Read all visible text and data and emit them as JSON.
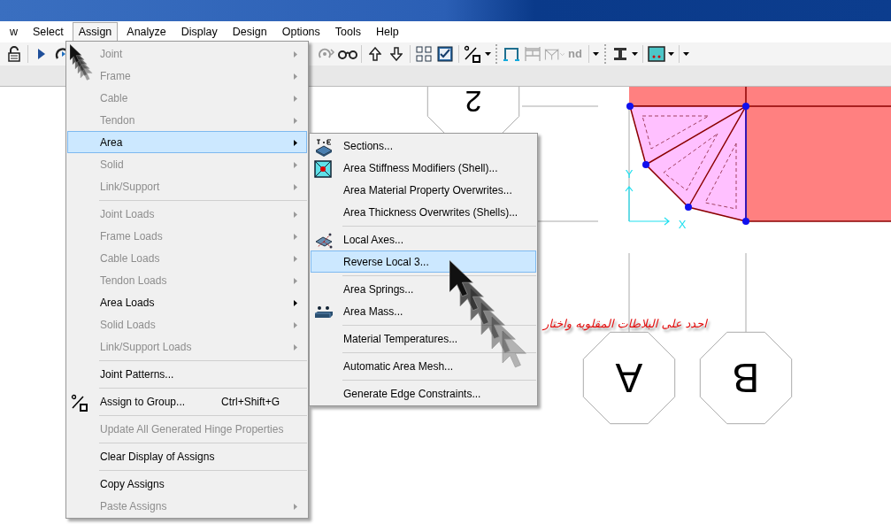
{
  "menubar": [
    {
      "label": "w",
      "selected": false
    },
    {
      "label": "Select",
      "selected": false
    },
    {
      "label": "Assign",
      "selected": true
    },
    {
      "label": "Analyze",
      "selected": false
    },
    {
      "label": "Display",
      "selected": false
    },
    {
      "label": "Design",
      "selected": false
    },
    {
      "label": "Options",
      "selected": false
    },
    {
      "label": "Tools",
      "selected": false
    },
    {
      "label": "Help",
      "selected": false
    }
  ],
  "toolbar": {
    "left": [
      {
        "kind": "icon"
      },
      {
        "kind": "sep"
      },
      {
        "kind": "icon"
      },
      {
        "kind": "icon"
      }
    ],
    "right": [
      {
        "kind": "icon"
      },
      {
        "kind": "icon"
      },
      {
        "kind": "sep"
      },
      {
        "kind": "icon"
      },
      {
        "kind": "icon"
      },
      {
        "kind": "sep"
      },
      {
        "kind": "icon"
      },
      {
        "kind": "icon"
      },
      {
        "kind": "sep"
      },
      {
        "kind": "icon"
      },
      {
        "kind": "caret"
      },
      {
        "kind": "grip"
      },
      {
        "kind": "icon"
      },
      {
        "kind": "icon"
      },
      {
        "kind": "icon"
      },
      {
        "kind": "text",
        "label": "nd",
        "disabled": true
      },
      {
        "kind": "sep"
      },
      {
        "kind": "caret"
      },
      {
        "kind": "grip"
      },
      {
        "kind": "icon"
      },
      {
        "kind": "caret"
      },
      {
        "kind": "sep"
      },
      {
        "kind": "icon"
      },
      {
        "kind": "caret"
      },
      {
        "kind": "sep"
      },
      {
        "kind": "caret"
      }
    ]
  },
  "assign_menu": [
    {
      "kind": "item",
      "label": "Joint",
      "disabled": true,
      "submenu": true,
      "selected": false
    },
    {
      "kind": "item",
      "label": "Frame",
      "disabled": true,
      "submenu": true,
      "selected": false
    },
    {
      "kind": "item",
      "label": "Cable",
      "disabled": true,
      "submenu": true,
      "selected": false
    },
    {
      "kind": "item",
      "label": "Tendon",
      "disabled": true,
      "submenu": true,
      "selected": false
    },
    {
      "kind": "item",
      "label": "Area",
      "disabled": false,
      "submenu": true,
      "selected": true
    },
    {
      "kind": "item",
      "label": "Solid",
      "disabled": true,
      "submenu": true,
      "selected": false
    },
    {
      "kind": "item",
      "label": "Link/Support",
      "disabled": true,
      "submenu": true,
      "selected": false
    },
    {
      "kind": "separator"
    },
    {
      "kind": "item",
      "label": "Joint Loads",
      "disabled": true,
      "submenu": true,
      "selected": false
    },
    {
      "kind": "item",
      "label": "Frame Loads",
      "disabled": true,
      "submenu": true,
      "selected": false
    },
    {
      "kind": "item",
      "label": "Cable Loads",
      "disabled": true,
      "submenu": true,
      "selected": false
    },
    {
      "kind": "item",
      "label": "Tendon Loads",
      "disabled": true,
      "submenu": true,
      "selected": false
    },
    {
      "kind": "item",
      "label": "Area Loads",
      "disabled": false,
      "submenu": true,
      "selected": false
    },
    {
      "kind": "item",
      "label": "Solid Loads",
      "disabled": true,
      "submenu": true,
      "selected": false
    },
    {
      "kind": "item",
      "label": "Link/Support Loads",
      "disabled": true,
      "submenu": true,
      "selected": false
    },
    {
      "kind": "separator"
    },
    {
      "kind": "item",
      "label": "Joint Patterns...",
      "disabled": false,
      "submenu": false,
      "selected": false
    },
    {
      "kind": "separator"
    },
    {
      "kind": "icon_item",
      "label": "Assign to Group...",
      "shortcut": "Ctrl+Shift+G",
      "disabled": false,
      "submenu": false,
      "selected": false
    },
    {
      "kind": "separator"
    },
    {
      "kind": "item",
      "label": "Update All Generated Hinge Properties",
      "disabled": true,
      "submenu": false,
      "selected": false
    },
    {
      "kind": "separator"
    },
    {
      "kind": "item",
      "label": "Clear Display of Assigns",
      "disabled": false,
      "submenu": false,
      "selected": false
    },
    {
      "kind": "separator"
    },
    {
      "kind": "item",
      "label": "Copy Assigns",
      "disabled": false,
      "submenu": false,
      "selected": false
    },
    {
      "kind": "item",
      "label": "Paste Assigns",
      "disabled": true,
      "submenu": true,
      "selected": false
    }
  ],
  "area_submenu": [
    {
      "kind": "icon_item",
      "label": "Sections...",
      "selected": false
    },
    {
      "kind": "icon_item",
      "label": "Area Stiffness Modifiers (Shell)...",
      "selected": false
    },
    {
      "kind": "item",
      "label": "Area Material Property Overwrites...",
      "selected": false
    },
    {
      "kind": "item",
      "label": "Area Thickness Overwrites (Shells)...",
      "selected": false
    },
    {
      "kind": "separator"
    },
    {
      "kind": "icon_item",
      "label": "Local Axes...",
      "selected": false
    },
    {
      "kind": "item",
      "label": "Reverse Local 3...",
      "selected": true
    },
    {
      "kind": "separator"
    },
    {
      "kind": "item",
      "label": "Area Springs...",
      "selected": false
    },
    {
      "kind": "icon_item",
      "label": "Area Mass...",
      "selected": false
    },
    {
      "kind": "separator"
    },
    {
      "kind": "item",
      "label": "Material Temperatures...",
      "selected": false
    },
    {
      "kind": "separator"
    },
    {
      "kind": "item",
      "label": "Automatic Area Mesh...",
      "selected": false
    },
    {
      "kind": "separator"
    },
    {
      "kind": "item",
      "label": "Generate Edge Constraints...",
      "selected": false
    }
  ],
  "canvas": {
    "grid_bubbles": [
      {
        "label": "2"
      },
      {
        "label": "A"
      },
      {
        "label": "B"
      }
    ],
    "axis_labels": {
      "y": "Y",
      "x": "X"
    },
    "annotation": "احدد على البلاطات المقلوبه واختار"
  }
}
